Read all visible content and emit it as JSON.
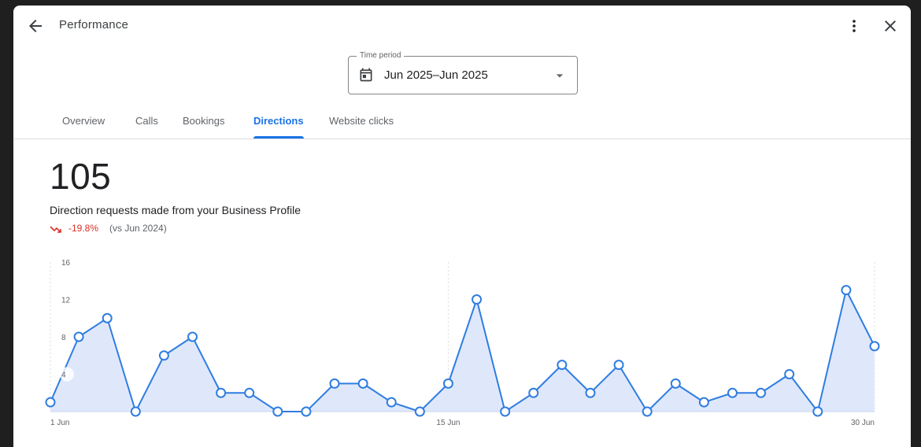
{
  "header": {
    "title": "Performance",
    "back_icon": "arrow-back-icon",
    "more_icon": "more-vert-icon",
    "close_icon": "close-icon"
  },
  "time_period": {
    "label": "Time period",
    "value": "Jun 2025–Jun 2025",
    "icon": "calendar-icon",
    "dropdown_icon": "arrow-drop-down-icon"
  },
  "tabs": [
    {
      "label": "Overview",
      "active": false
    },
    {
      "label": "Calls",
      "active": false
    },
    {
      "label": "Bookings",
      "active": false
    },
    {
      "label": "Directions",
      "active": true
    },
    {
      "label": "Website clicks",
      "active": false
    }
  ],
  "metric": {
    "value": "105",
    "description": "Direction requests made from your Business Profile",
    "change": "-19.8%",
    "comparison": "(vs Jun 2024)",
    "change_icon": "trending-down-icon",
    "change_color": "#d93025"
  },
  "colors": {
    "accent": "#1a73e8",
    "line": "#2f7de1",
    "area": "#dfe8fb"
  },
  "chart_data": {
    "type": "area",
    "x": [
      1,
      2,
      3,
      4,
      5,
      6,
      7,
      8,
      9,
      10,
      11,
      12,
      13,
      14,
      15,
      16,
      17,
      18,
      19,
      20,
      21,
      22,
      23,
      24,
      25,
      26,
      27,
      28,
      29,
      30
    ],
    "values": [
      1,
      8,
      10,
      0,
      6,
      8,
      2,
      2,
      0,
      0,
      3,
      3,
      1,
      0,
      3,
      12,
      0,
      2,
      5,
      2,
      5,
      0,
      3,
      1,
      2,
      2,
      4,
      0,
      13,
      7
    ],
    "ylim": [
      0,
      16
    ],
    "yticks": [
      "16",
      "12",
      "8",
      "4"
    ],
    "xticks": [
      {
        "day": 1,
        "label": "1 Jun"
      },
      {
        "day": 15,
        "label": "15 Jun"
      },
      {
        "day": 30,
        "label": "30 Jun"
      }
    ],
    "grid": "vertical dashed at labeled days"
  }
}
